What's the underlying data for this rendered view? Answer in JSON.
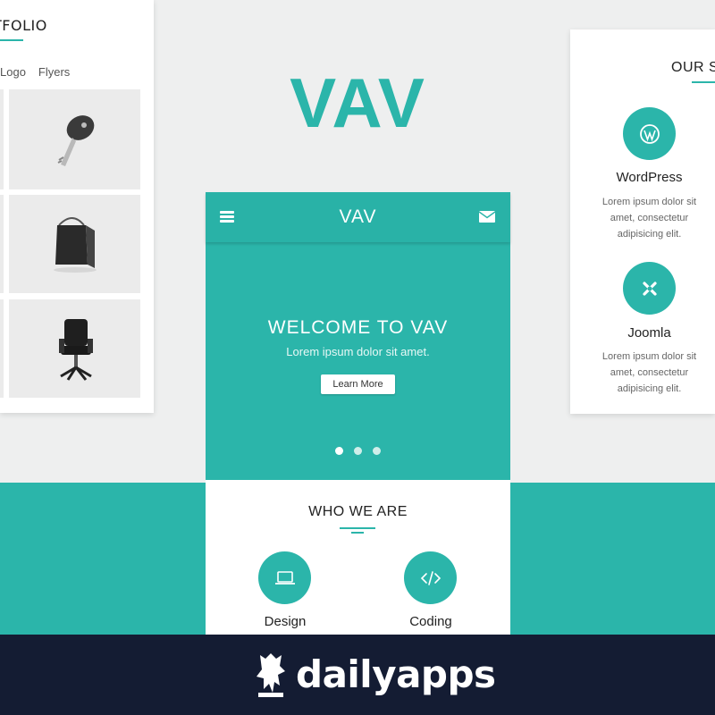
{
  "portfolio": {
    "title": "TFOLIO",
    "filters": [
      "Logo",
      "Flyers"
    ]
  },
  "hero_title": "VAV",
  "phone": {
    "logo": "VAV",
    "welcome_title": "WELCOME TO VAV",
    "welcome_subtitle": "Lorem ipsum dolor sit amet.",
    "cta_label": "Learn More",
    "slide_count": 3,
    "active_slide": 1,
    "section_title": "WHO WE ARE",
    "features": [
      {
        "label": "Design",
        "icon": "laptop-icon"
      },
      {
        "label": "Coding",
        "icon": "code-icon"
      }
    ]
  },
  "services": {
    "title": "OUR S",
    "items": [
      {
        "name": "WordPress",
        "icon": "wordpress-icon",
        "desc_lines": [
          "Lorem ipsum dolor sit",
          "amet, consectetur",
          "adipisicing elit."
        ]
      },
      {
        "name": "Joomla",
        "icon": "joomla-icon",
        "desc_lines": [
          "Lorem ipsum dolor sit",
          "amet, consectetur",
          "adipisicing elit."
        ]
      }
    ]
  },
  "footer": {
    "brand": "dailyapps"
  },
  "colors": {
    "accent": "#2bb5aa",
    "background": "#eeefef",
    "footer": "#141c33"
  }
}
